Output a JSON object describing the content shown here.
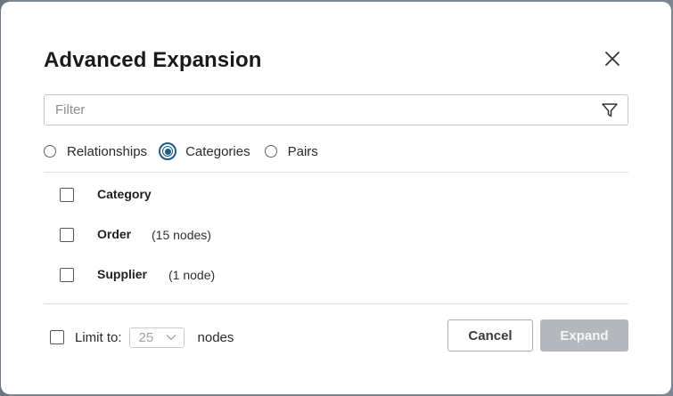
{
  "dialog": {
    "title": "Advanced Expansion"
  },
  "filter": {
    "placeholder": "Filter",
    "value": ""
  },
  "mode": {
    "options": [
      {
        "label": "Relationships",
        "selected": false
      },
      {
        "label": "Categories",
        "selected": true
      },
      {
        "label": "Pairs",
        "selected": false
      }
    ]
  },
  "categories": [
    {
      "name": "Category",
      "count": "",
      "checked": false
    },
    {
      "name": "Order",
      "count": "(15 nodes)",
      "checked": false
    },
    {
      "name": "Supplier",
      "count": "(1 node)",
      "checked": false
    }
  ],
  "footer": {
    "limit_label": "Limit to:",
    "limit_value": "25",
    "limit_checked": false,
    "nodes_label": "nodes",
    "cancel_label": "Cancel",
    "expand_label": "Expand",
    "expand_enabled": false
  },
  "icons": {
    "close": "close-icon",
    "filter": "filter-funnel-icon",
    "chevron": "chevron-down-icon"
  },
  "colors": {
    "accent": "#1c5b87",
    "disabled_button": "#b4b8bd"
  }
}
